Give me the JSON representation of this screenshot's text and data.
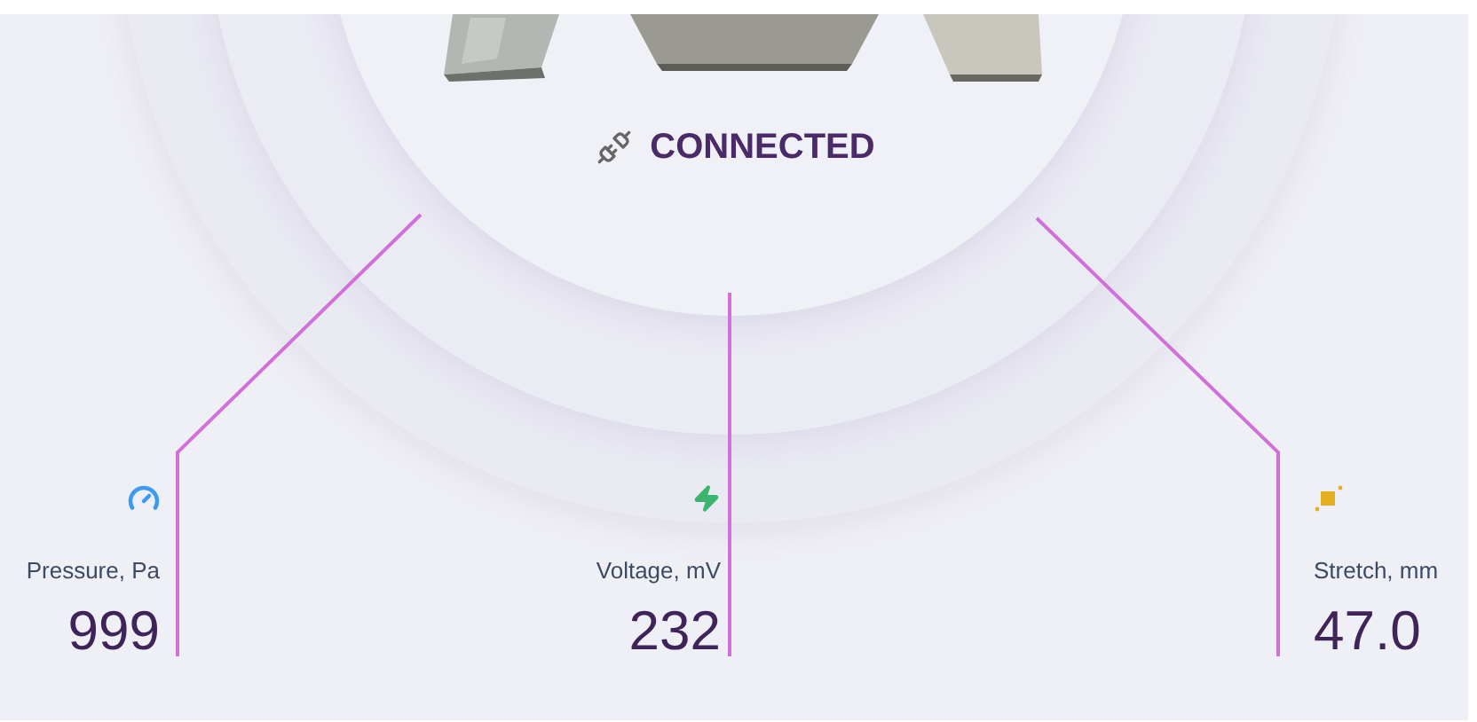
{
  "status": {
    "text": "CONNECTED"
  },
  "sensors": [
    {
      "kind": "pressure",
      "label": "Pressure, Pa",
      "value": "999"
    },
    {
      "kind": "voltage",
      "label": "Voltage, mV",
      "value": "232"
    },
    {
      "kind": "stretch",
      "label": "Stretch, mm",
      "value": "47.0"
    }
  ]
}
